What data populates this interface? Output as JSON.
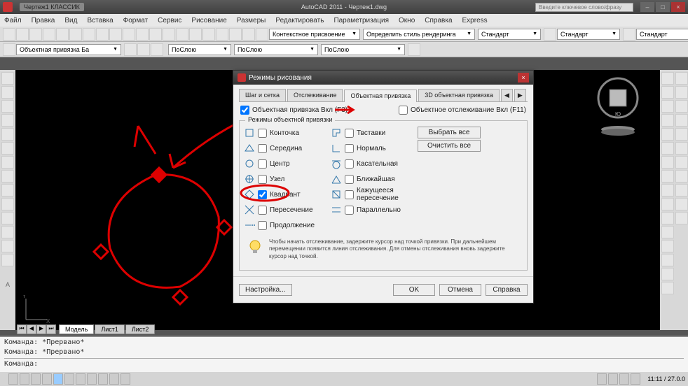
{
  "titlebar": {
    "doc_tab": "Чертеж1 КЛАССИК",
    "title": "AutoCAD 2011 - Чертеж1.dwg",
    "search_placeholder": "Введите ключевое слово/фразу"
  },
  "menu": [
    "Файл",
    "Правка",
    "Вид",
    "Вставка",
    "Формат",
    "Сервис",
    "Рисование",
    "Размеры",
    "Редактировать",
    "Параметризация",
    "Окно",
    "Справка",
    "Express"
  ],
  "dropdowns": {
    "layer": "Объектная привязка Ба",
    "color": "ПоСлою",
    "ltype": "ПоСлою",
    "lweight": "ПоСлою",
    "annot1": "Контекстное присвоение",
    "style1": "Определить стиль рендеринга",
    "style2": "Стандарт",
    "style3": "Стандарт",
    "style4": "Стандарт"
  },
  "dialog": {
    "title": "Режимы рисования",
    "tabs": [
      "Шаг и сетка",
      "Отслеживание",
      "Объектная привязка",
      "3D объектная привязка"
    ],
    "top_checks": {
      "osnap_on": "Объектная привязка Вкл (F3)",
      "otrack_on": "Объектное отслеживание Вкл (F11)"
    },
    "fieldset_legend": "Режимы объектной привязки",
    "snaps_left": [
      {
        "k": "Конточка"
      },
      {
        "k": "Середина"
      },
      {
        "k": "Центр"
      },
      {
        "k": "Узел"
      },
      {
        "k": "Квадрант"
      },
      {
        "k": "Пересечение"
      },
      {
        "k": "Продолжение"
      }
    ],
    "snaps_right": [
      {
        "k": "Твставки"
      },
      {
        "k": "Нормаль"
      },
      {
        "k": "Касательная"
      },
      {
        "k": "Ближайшая"
      },
      {
        "k": "Кажущееся пересечение"
      },
      {
        "k": "Параллельно"
      }
    ],
    "btn_select_all": "Выбрать все",
    "btn_clear_all": "Очистить все",
    "tip": "Чтобы начать отслеживание, задержите курсор над точкой привязки. При дальнейшем перемещении появится линия отслеживания. Для отмены отслеживания вновь задержите курсор над точкой.",
    "btn_options": "Настройка...",
    "btn_ok": "OK",
    "btn_cancel": "Отмена",
    "btn_help": "Справка"
  },
  "model_tabs": [
    "Модель",
    "Лист1",
    "Лист2"
  ],
  "cmd": {
    "line1": "Команда: *Прервано*",
    "line2": "Команда: *Прервано*",
    "prompt": "Команда:"
  },
  "status": {
    "coords": "",
    "clock": "11:11 / 27.0.0"
  }
}
